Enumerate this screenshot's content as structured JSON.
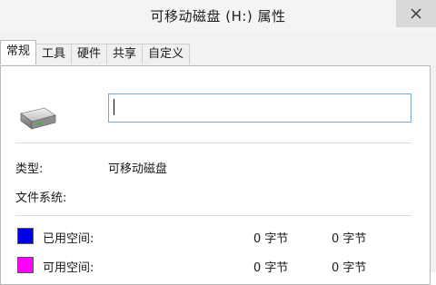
{
  "window": {
    "title": "可移动磁盘 (H:) 属性"
  },
  "tabs": [
    {
      "label": "常规",
      "active": true
    },
    {
      "label": "工具",
      "active": false
    },
    {
      "label": "硬件",
      "active": false
    },
    {
      "label": "共享",
      "active": false
    },
    {
      "label": "自定义",
      "active": false
    }
  ],
  "general": {
    "drive_icon": "removable-drive-icon",
    "name_value": "",
    "type_label": "类型:",
    "type_value": "可移动磁盘",
    "fs_label": "文件系统:",
    "fs_value": "",
    "used_label": "已用空间:",
    "used_bytes": "0 字节",
    "used_size": "0 字节",
    "used_color": "#0000e6",
    "free_label": "可用空间:",
    "free_bytes": "0 字节",
    "free_size": "0 字节",
    "free_color": "#ff00ff"
  }
}
